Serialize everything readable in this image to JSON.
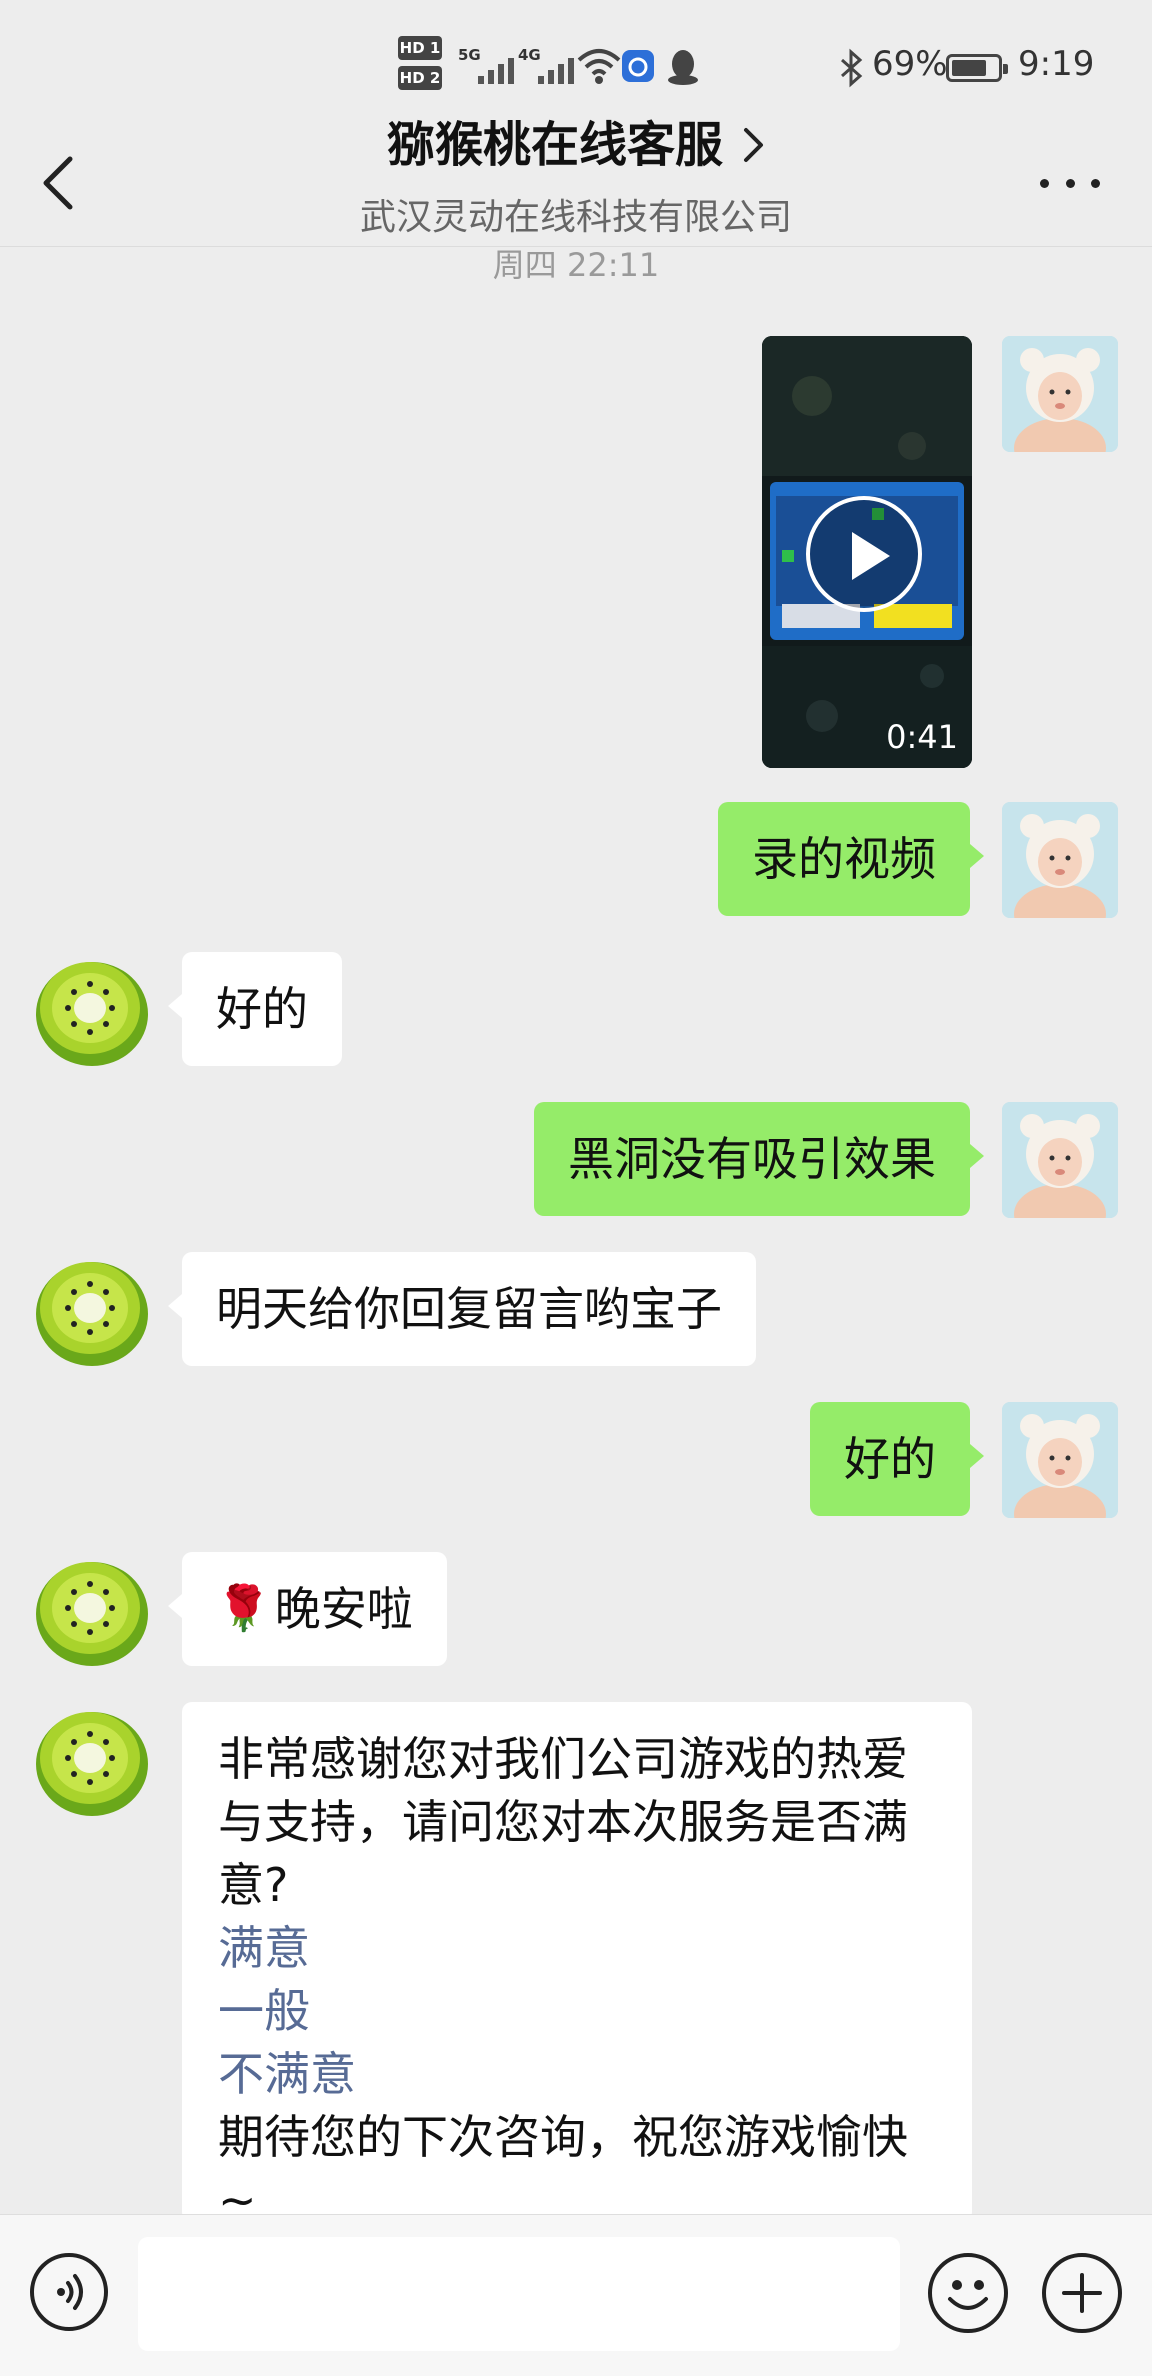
{
  "status_bar": {
    "hd1": "HD 1",
    "hd2": "HD 2",
    "net1": "5G",
    "net2": "4G",
    "battery_percent": "69%",
    "time": "9:19"
  },
  "header": {
    "title": "猕猴桃在线客服",
    "subtitle": "武汉灵动在线科技有限公司"
  },
  "timestamp": "周四 22:11",
  "messages": [
    {
      "from": "me",
      "type": "video",
      "duration": "0:41"
    },
    {
      "from": "me",
      "type": "text",
      "text": "录的视频"
    },
    {
      "from": "cs",
      "type": "text",
      "text": "好的"
    },
    {
      "from": "me",
      "type": "text",
      "text": "黑洞没有吸引效果"
    },
    {
      "from": "cs",
      "type": "text",
      "text": "明天给你回复留言哟宝子"
    },
    {
      "from": "me",
      "type": "text",
      "text": "好的"
    },
    {
      "from": "cs",
      "type": "text",
      "emoji": "🌹",
      "text": "晚安啦"
    },
    {
      "from": "cs",
      "type": "survey",
      "lines": [
        "非常感谢您对我们公司游戏的热爱",
        "与支持，请问您对本次服务是否满",
        "意?"
      ],
      "options": [
        "满意",
        "一般",
        "不满意"
      ],
      "closing": [
        "期待您的下次咨询，祝您游戏愉快",
        "~"
      ]
    }
  ],
  "input": {
    "placeholder": ""
  },
  "colors": {
    "my_bubble": "#95ec69",
    "their_bubble": "#ffffff",
    "link": "#576b95",
    "background": "#ededed"
  },
  "icons": [
    "back-arrow-icon",
    "chevron-right-icon",
    "more-icon",
    "voice-icon",
    "emoji-icon",
    "plus-icon",
    "bluetooth-icon",
    "wifi-icon",
    "battery-icon",
    "alarm-icon",
    "qq-icon",
    "play-icon"
  ]
}
